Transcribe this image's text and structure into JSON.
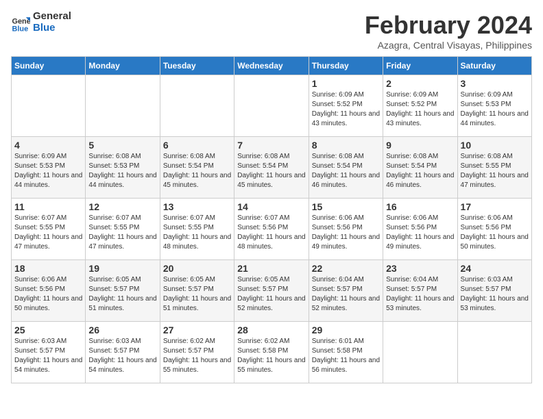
{
  "logo": {
    "line1": "General",
    "line2": "Blue"
  },
  "title": "February 2024",
  "location": "Azagra, Central Visayas, Philippines",
  "days_header": [
    "Sunday",
    "Monday",
    "Tuesday",
    "Wednesday",
    "Thursday",
    "Friday",
    "Saturday"
  ],
  "weeks": [
    [
      {
        "day": "",
        "info": ""
      },
      {
        "day": "",
        "info": ""
      },
      {
        "day": "",
        "info": ""
      },
      {
        "day": "",
        "info": ""
      },
      {
        "day": "1",
        "info": "Sunrise: 6:09 AM\nSunset: 5:52 PM\nDaylight: 11 hours and 43 minutes."
      },
      {
        "day": "2",
        "info": "Sunrise: 6:09 AM\nSunset: 5:52 PM\nDaylight: 11 hours and 43 minutes."
      },
      {
        "day": "3",
        "info": "Sunrise: 6:09 AM\nSunset: 5:53 PM\nDaylight: 11 hours and 44 minutes."
      }
    ],
    [
      {
        "day": "4",
        "info": "Sunrise: 6:09 AM\nSunset: 5:53 PM\nDaylight: 11 hours and 44 minutes."
      },
      {
        "day": "5",
        "info": "Sunrise: 6:08 AM\nSunset: 5:53 PM\nDaylight: 11 hours and 44 minutes."
      },
      {
        "day": "6",
        "info": "Sunrise: 6:08 AM\nSunset: 5:54 PM\nDaylight: 11 hours and 45 minutes."
      },
      {
        "day": "7",
        "info": "Sunrise: 6:08 AM\nSunset: 5:54 PM\nDaylight: 11 hours and 45 minutes."
      },
      {
        "day": "8",
        "info": "Sunrise: 6:08 AM\nSunset: 5:54 PM\nDaylight: 11 hours and 46 minutes."
      },
      {
        "day": "9",
        "info": "Sunrise: 6:08 AM\nSunset: 5:54 PM\nDaylight: 11 hours and 46 minutes."
      },
      {
        "day": "10",
        "info": "Sunrise: 6:08 AM\nSunset: 5:55 PM\nDaylight: 11 hours and 47 minutes."
      }
    ],
    [
      {
        "day": "11",
        "info": "Sunrise: 6:07 AM\nSunset: 5:55 PM\nDaylight: 11 hours and 47 minutes."
      },
      {
        "day": "12",
        "info": "Sunrise: 6:07 AM\nSunset: 5:55 PM\nDaylight: 11 hours and 47 minutes."
      },
      {
        "day": "13",
        "info": "Sunrise: 6:07 AM\nSunset: 5:55 PM\nDaylight: 11 hours and 48 minutes."
      },
      {
        "day": "14",
        "info": "Sunrise: 6:07 AM\nSunset: 5:56 PM\nDaylight: 11 hours and 48 minutes."
      },
      {
        "day": "15",
        "info": "Sunrise: 6:06 AM\nSunset: 5:56 PM\nDaylight: 11 hours and 49 minutes."
      },
      {
        "day": "16",
        "info": "Sunrise: 6:06 AM\nSunset: 5:56 PM\nDaylight: 11 hours and 49 minutes."
      },
      {
        "day": "17",
        "info": "Sunrise: 6:06 AM\nSunset: 5:56 PM\nDaylight: 11 hours and 50 minutes."
      }
    ],
    [
      {
        "day": "18",
        "info": "Sunrise: 6:06 AM\nSunset: 5:56 PM\nDaylight: 11 hours and 50 minutes."
      },
      {
        "day": "19",
        "info": "Sunrise: 6:05 AM\nSunset: 5:57 PM\nDaylight: 11 hours and 51 minutes."
      },
      {
        "day": "20",
        "info": "Sunrise: 6:05 AM\nSunset: 5:57 PM\nDaylight: 11 hours and 51 minutes."
      },
      {
        "day": "21",
        "info": "Sunrise: 6:05 AM\nSunset: 5:57 PM\nDaylight: 11 hours and 52 minutes."
      },
      {
        "day": "22",
        "info": "Sunrise: 6:04 AM\nSunset: 5:57 PM\nDaylight: 11 hours and 52 minutes."
      },
      {
        "day": "23",
        "info": "Sunrise: 6:04 AM\nSunset: 5:57 PM\nDaylight: 11 hours and 53 minutes."
      },
      {
        "day": "24",
        "info": "Sunrise: 6:03 AM\nSunset: 5:57 PM\nDaylight: 11 hours and 53 minutes."
      }
    ],
    [
      {
        "day": "25",
        "info": "Sunrise: 6:03 AM\nSunset: 5:57 PM\nDaylight: 11 hours and 54 minutes."
      },
      {
        "day": "26",
        "info": "Sunrise: 6:03 AM\nSunset: 5:57 PM\nDaylight: 11 hours and 54 minutes."
      },
      {
        "day": "27",
        "info": "Sunrise: 6:02 AM\nSunset: 5:57 PM\nDaylight: 11 hours and 55 minutes."
      },
      {
        "day": "28",
        "info": "Sunrise: 6:02 AM\nSunset: 5:58 PM\nDaylight: 11 hours and 55 minutes."
      },
      {
        "day": "29",
        "info": "Sunrise: 6:01 AM\nSunset: 5:58 PM\nDaylight: 11 hours and 56 minutes."
      },
      {
        "day": "",
        "info": ""
      },
      {
        "day": "",
        "info": ""
      }
    ]
  ]
}
